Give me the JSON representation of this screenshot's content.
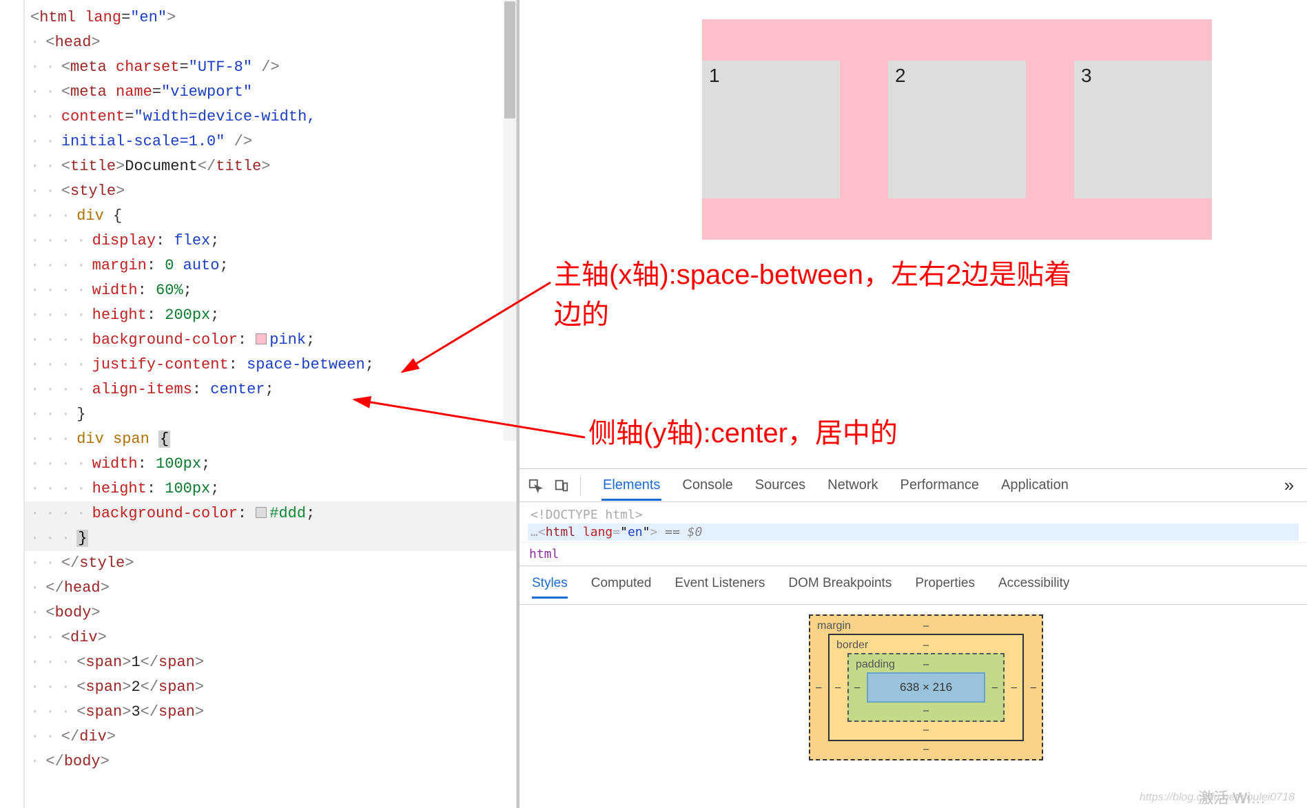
{
  "code": {
    "lines": [
      {
        "indent": 0,
        "html": "<span class='tag-bracket'>&lt;</span><span class='tag-name'>html</span> <span class='attr-name'>lang</span><span class='punct'>=</span><span class='attr-val'>\"en\"</span><span class='tag-bracket'>&gt;</span>"
      },
      {
        "indent": 1,
        "html": "<span class='tag-bracket'>&lt;</span><span class='tag-name'>head</span><span class='tag-bracket'>&gt;</span>"
      },
      {
        "indent": 2,
        "html": "<span class='tag-bracket'>&lt;</span><span class='tag-name'>meta</span> <span class='attr-name'>charset</span><span class='punct'>=</span><span class='attr-val'>\"UTF-8\"</span> <span class='tag-bracket'>/&gt;</span>"
      },
      {
        "indent": 2,
        "html": "<span class='tag-bracket'>&lt;</span><span class='tag-name'>meta</span> <span class='attr-name'>name</span><span class='punct'>=</span><span class='attr-val'>\"viewport\"</span>"
      },
      {
        "indent": 2,
        "html": "<span class='attr-name'>content</span><span class='punct'>=</span><span class='attr-val'>\"width=device-width,</span>"
      },
      {
        "indent": 2,
        "html": "<span class='attr-val'>initial-scale=1.0\"</span> <span class='tag-bracket'>/&gt;</span>"
      },
      {
        "indent": 2,
        "html": "<span class='tag-bracket'>&lt;</span><span class='tag-name'>title</span><span class='tag-bracket'>&gt;</span><span class='txt'>Document</span><span class='tag-bracket'>&lt;/</span><span class='tag-name'>title</span><span class='tag-bracket'>&gt;</span>"
      },
      {
        "indent": 2,
        "html": "<span class='tag-bracket'>&lt;</span><span class='tag-name'>style</span><span class='tag-bracket'>&gt;</span>"
      },
      {
        "indent": 3,
        "html": "<span class='css-sel'>div</span> <span class='punct'>{</span>"
      },
      {
        "indent": 4,
        "html": "<span class='css-prop'>display</span><span class='punct'>:</span> <span class='css-kw'>flex</span><span class='punct'>;</span>"
      },
      {
        "indent": 4,
        "html": "<span class='css-prop'>margin</span><span class='punct'>:</span> <span class='css-val-num'>0</span> <span class='css-kw'>auto</span><span class='punct'>;</span>"
      },
      {
        "indent": 4,
        "html": "<span class='css-prop'>width</span><span class='punct'>:</span> <span class='css-val-num'>60%</span><span class='punct'>;</span>"
      },
      {
        "indent": 4,
        "html": "<span class='css-prop'>height</span><span class='punct'>:</span> <span class='css-val-num'>200px</span><span class='punct'>;</span>"
      },
      {
        "indent": 4,
        "html": "<span class='css-prop'>background-color</span><span class='punct'>:</span> <span class='swatch sw-pink'></span><span class='css-kw'>pink</span><span class='punct'>;</span>"
      },
      {
        "indent": 4,
        "html": "<span class='css-prop'>justify-content</span><span class='punct'>:</span> <span class='css-kw'>space-between</span><span class='punct'>;</span>"
      },
      {
        "indent": 4,
        "html": "<span class='css-prop'>align-items</span><span class='punct'>:</span> <span class='css-kw'>center</span><span class='punct'>;</span>"
      },
      {
        "indent": 3,
        "html": "<span class='punct'>}</span>"
      },
      {
        "indent": 3,
        "html": "<span class='css-sel'>div span</span> <span class='sel-brace'>{</span>"
      },
      {
        "indent": 4,
        "html": "<span class='css-prop'>width</span><span class='punct'>:</span> <span class='css-val-num'>100px</span><span class='punct'>;</span>"
      },
      {
        "indent": 4,
        "html": "<span class='css-prop'>height</span><span class='punct'>:</span> <span class='css-val-num'>100px</span><span class='punct'>;</span>"
      },
      {
        "indent": 4,
        "hl": true,
        "html": "<span class='css-prop'>background-color</span><span class='punct'>:</span> <span class='swatch sw-ddd'></span><span class='css-val'>#ddd</span><span class='punct'>;</span>"
      },
      {
        "indent": 3,
        "hl": true,
        "html": "<span class='sel-brace'>}</span>"
      },
      {
        "indent": 2,
        "html": "<span class='tag-bracket'>&lt;/</span><span class='tag-name'>style</span><span class='tag-bracket'>&gt;</span>"
      },
      {
        "indent": 1,
        "html": "<span class='tag-bracket'>&lt;/</span><span class='tag-name'>head</span><span class='tag-bracket'>&gt;</span>"
      },
      {
        "indent": 1,
        "html": "<span class='tag-bracket'>&lt;</span><span class='tag-name'>body</span><span class='tag-bracket'>&gt;</span>"
      },
      {
        "indent": 2,
        "html": "<span class='tag-bracket'>&lt;</span><span class='tag-name'>div</span><span class='tag-bracket'>&gt;</span>"
      },
      {
        "indent": 3,
        "html": "<span class='tag-bracket'>&lt;</span><span class='tag-name'>span</span><span class='tag-bracket'>&gt;</span><span class='txt'>1</span><span class='tag-bracket'>&lt;/</span><span class='tag-name'>span</span><span class='tag-bracket'>&gt;</span>"
      },
      {
        "indent": 3,
        "html": "<span class='tag-bracket'>&lt;</span><span class='tag-name'>span</span><span class='tag-bracket'>&gt;</span><span class='txt'>2</span><span class='tag-bracket'>&lt;/</span><span class='tag-name'>span</span><span class='tag-bracket'>&gt;</span>"
      },
      {
        "indent": 3,
        "html": "<span class='tag-bracket'>&lt;</span><span class='tag-name'>span</span><span class='tag-bracket'>&gt;</span><span class='txt'>3</span><span class='tag-bracket'>&lt;/</span><span class='tag-name'>span</span><span class='tag-bracket'>&gt;</span>"
      },
      {
        "indent": 2,
        "html": "<span class='tag-bracket'>&lt;/</span><span class='tag-name'>div</span><span class='tag-bracket'>&gt;</span>"
      },
      {
        "indent": 1,
        "html": "<span class='tag-bracket'>&lt;/</span><span class='tag-name'>body</span><span class='tag-bracket'>&gt;</span>"
      }
    ]
  },
  "preview": {
    "items": [
      "1",
      "2",
      "3"
    ]
  },
  "annotations": {
    "a1": "主轴(x轴):space-between，左右2边是贴着边的",
    "a2": "侧轴(y轴):center，居中的"
  },
  "devtools": {
    "tabs": [
      "Elements",
      "Console",
      "Sources",
      "Network",
      "Performance",
      "Application"
    ],
    "activeTab": "Elements",
    "overflow": "»",
    "dom": {
      "doctype": "<!DOCTYPE html>",
      "line_prefix": "…",
      "line_open": "<html lang=\"en\">",
      "line_eq": " == ",
      "line_var": "$0"
    },
    "crumb": "html",
    "subtabs": [
      "Styles",
      "Computed",
      "Event Listeners",
      "DOM Breakpoints",
      "Properties",
      "Accessibility"
    ],
    "activeSub": "Styles",
    "boxmodel": {
      "margin": "margin",
      "border": "border",
      "padding": "padding",
      "margin_vals": {
        "t": "–",
        "r": "–",
        "b": "–",
        "l": "–"
      },
      "border_vals": {
        "t": "–",
        "r": "–",
        "b": "–",
        "l": "–"
      },
      "padding_vals": {
        "t": "–",
        "r": "–",
        "b": "–",
        "l": "–"
      },
      "content": "638 × 216"
    }
  },
  "watermark": "https://blog.csdn.net/youlei0718",
  "activate": "激活 Wi…"
}
